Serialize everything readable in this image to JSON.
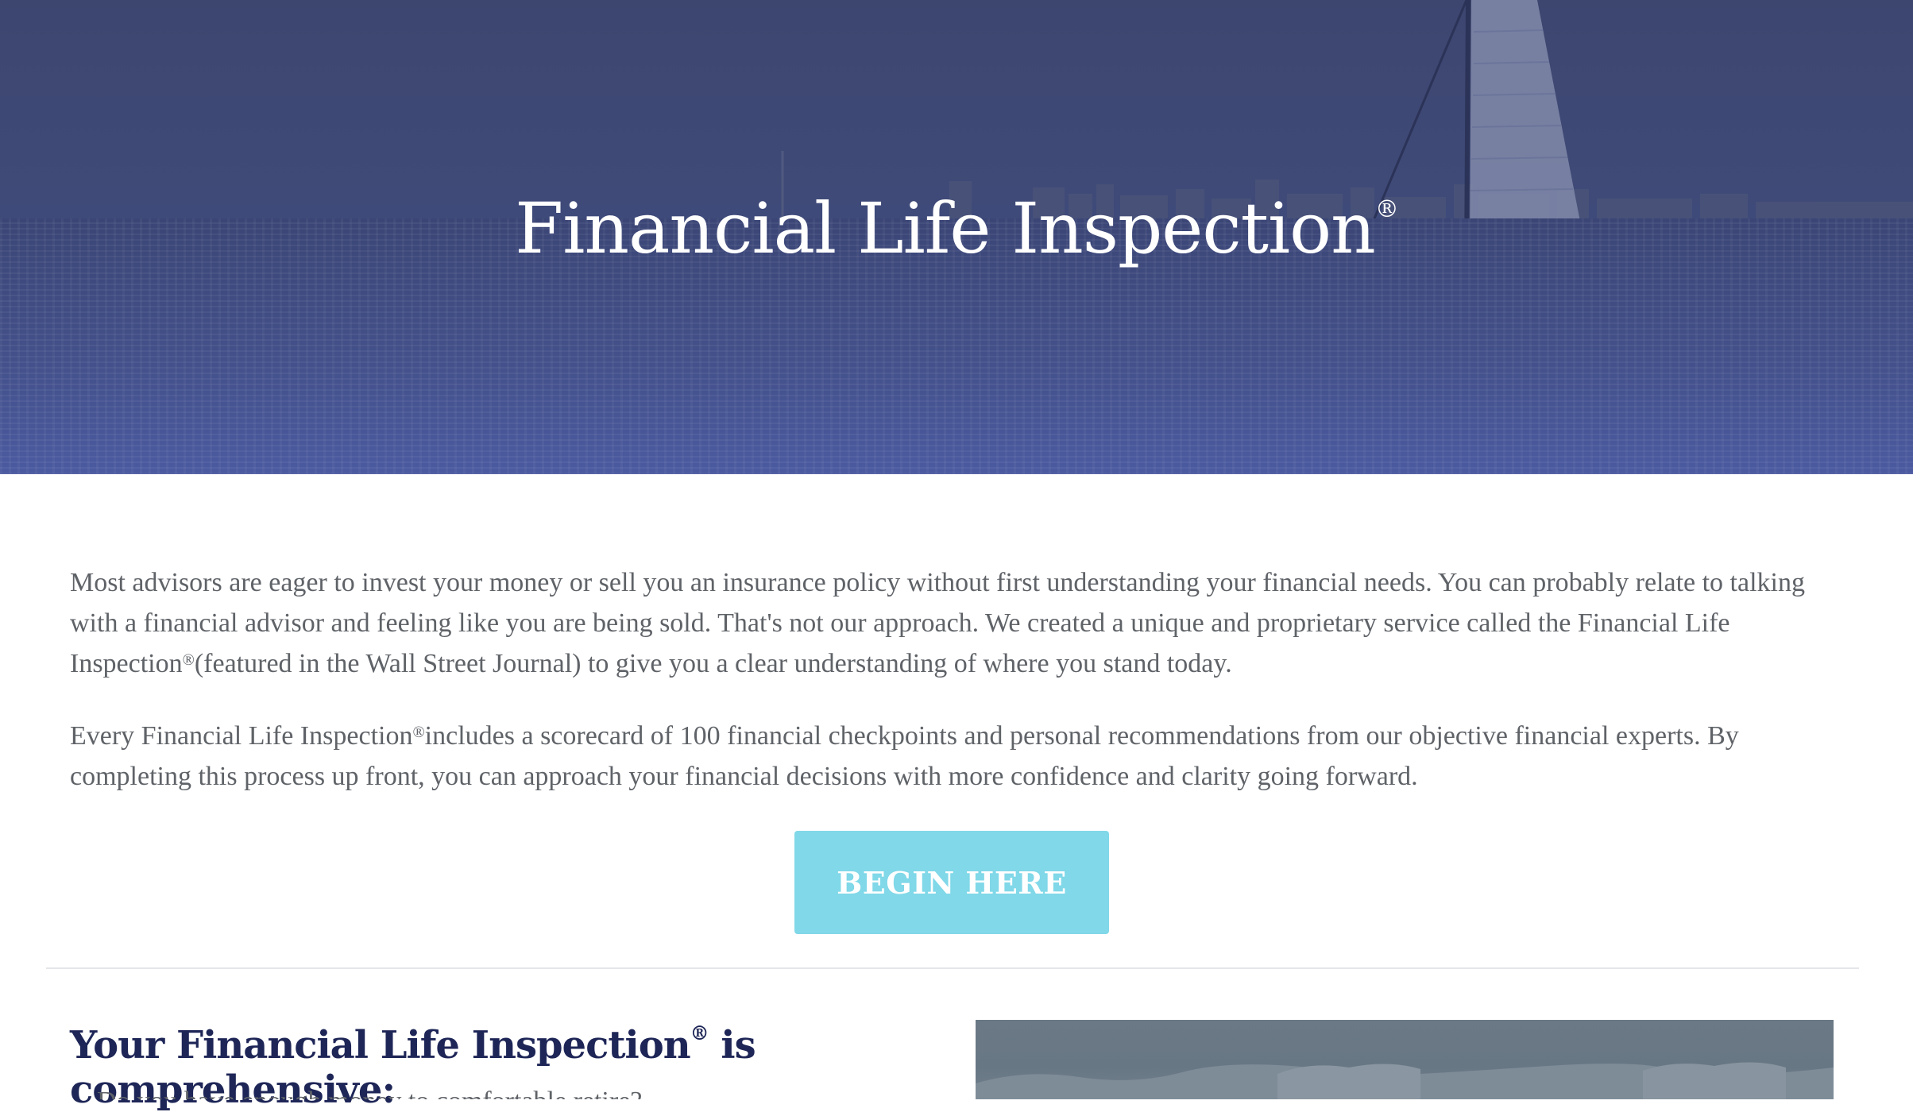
{
  "hero": {
    "title": "Financial Life Inspection",
    "title_mark": "®"
  },
  "intro": {
    "p1_before": "Most advisors are eager to invest your money or sell you an insurance policy without first understanding your financial needs. You can probably relate to talking with a financial advisor and feeling like you are being sold. That's not our approach. We created a unique and proprietary service called the Financial Life Inspection",
    "p1_mark": "®",
    "p1_after": "(featured in the Wall Street Journal) to give you a clear understanding of where you stand today.",
    "p2_before": "Every Financial Life Inspection",
    "p2_mark": "®",
    "p2_after": "includes a scorecard of 100 financial checkpoints and personal recommendations from our objective financial experts. By completing this process up front, you can approach your financial decisions with more confidence and clarity going forward."
  },
  "cta": {
    "label": "BEGIN HERE"
  },
  "section": {
    "heading_before": "Your Financial Life Inspection",
    "heading_mark": "®",
    "heading_after": " is comprehensive:",
    "first_item_partial": "Do you have enough money to comfortable retire?"
  },
  "colors": {
    "hero_overlay": "#3e4878",
    "cta_background": "#80d8e8",
    "heading_navy": "#1e2657",
    "body_text": "#5f6368"
  }
}
